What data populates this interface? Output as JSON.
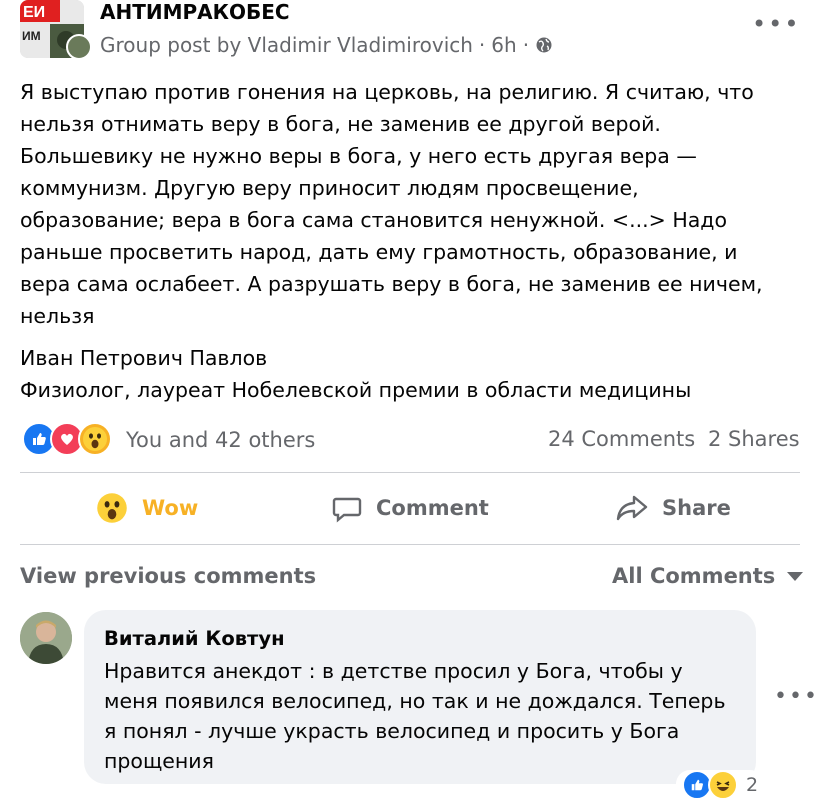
{
  "post": {
    "group_name": "АНТИМРАКОБЕС",
    "meta_prefix": "Group post by Vladimir Vladimirovich",
    "meta_separator": "·",
    "time": "6h",
    "privacy_icon": "globe-icon",
    "more_icon": "more-icon",
    "text": "Я выступаю против гонения на церковь, на религию. Я считаю, что\nнельзя отнимать веру в бога, не заменив ее другой верой.\nБольшевику не нужно веры в бога, у него есть другая вера —\nкоммунизм. Другую веру приносит людям просвещение,\nобразование; вера в бога сама становится ненужной. <...> Надо\nраньше просветить народ, дать ему грамотность, образование, и\nвера сама ослабеет. А разрушать веру в бога, не заменив ее ничем,\nнельзя",
    "author": "Иван Петрович Павлов",
    "author_title": "Физиолог, лауреат Нобелевской премии в области медицины"
  },
  "reactions": {
    "icons": [
      "like-icon",
      "love-icon",
      "wow-icon"
    ],
    "summary": "You and 42 others",
    "comments": "24 Comments",
    "shares": "2 Shares"
  },
  "actions": {
    "wow": "Wow",
    "comment": "Comment",
    "share": "Share"
  },
  "comments_section": {
    "view_previous": "View previous comments",
    "all_comments": "All Comments"
  },
  "comment": {
    "author": "Виталий Ковтун",
    "text": "Нравится анекдот : в детстве просил у Бога, чтобы у\nменя появился велосипед, но так и не дождался. Теперь\nя понял - лучше украсть велосипед и просить у Бога\nпрощения",
    "reaction_icons": [
      "like-icon",
      "haha-icon"
    ],
    "reaction_count": "2"
  },
  "colors": {
    "secondary_text": "#65676b",
    "like_blue": "#1877f2",
    "love_red": "#f33e58",
    "wow_yellow": "#f7b125",
    "bubble_bg": "#f0f2f5"
  }
}
